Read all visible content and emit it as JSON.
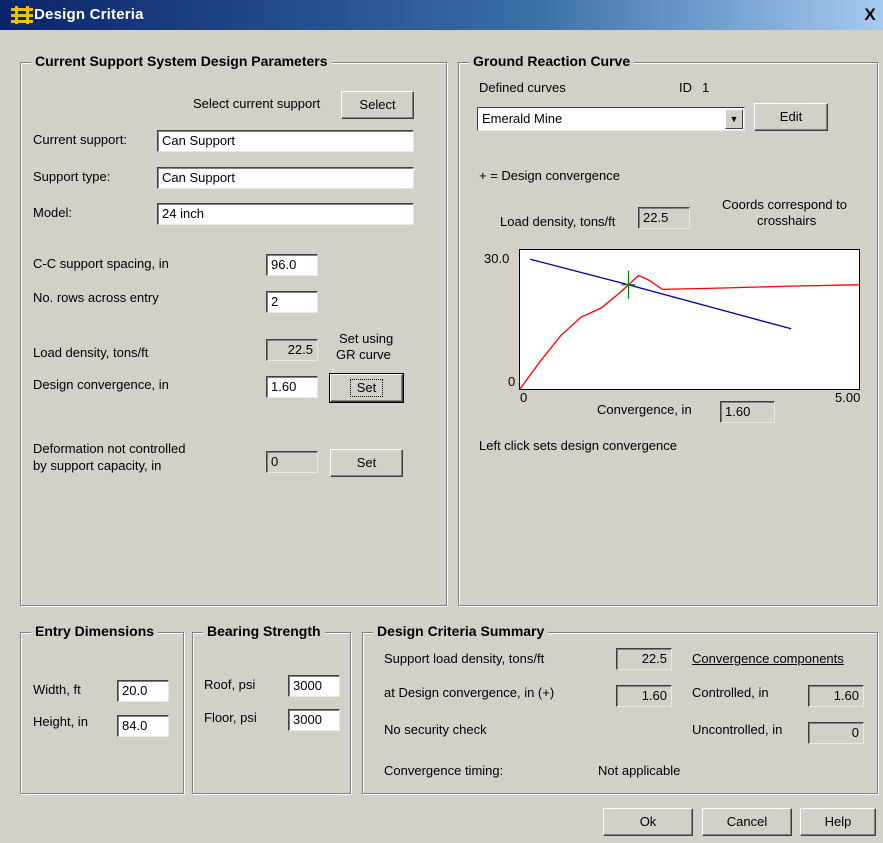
{
  "window": {
    "title": "Design Criteria",
    "close_label": "X"
  },
  "params": {
    "legend": "Current Support System Design Parameters",
    "select_label": "Select current support",
    "select_button": "Select",
    "current_support_label": "Current support:",
    "current_support_value": "Can Support",
    "support_type_label": "Support type:",
    "support_type_value": "Can Support",
    "model_label": "Model:",
    "model_value": "24 inch",
    "spacing_label": "C-C support spacing, in",
    "spacing_value": "96.0",
    "rows_label": "No. rows across entry",
    "rows_value": "2",
    "load_density_label": "Load density, tons/ft",
    "load_density_value": "22.5",
    "set_using_line1": "Set using",
    "set_using_line2": "GR curve",
    "design_conv_label": "Design convergence, in",
    "design_conv_value": "1.60",
    "set_button": "Set",
    "deform_label_line1": "Deformation not controlled",
    "deform_label_line2": "by support capacity, in",
    "deform_value": "0",
    "set_button2": "Set"
  },
  "grc": {
    "legend": "Ground Reaction Curve",
    "defined_curves_label": "Defined curves",
    "id_label": "ID",
    "id_value": "1",
    "curve_selected": "Emerald Mine",
    "edit_button": "Edit",
    "design_conv_note": "+ = Design convergence",
    "load_density_label": "Load density, tons/ft",
    "load_density_value": "22.5",
    "coords_line1": "Coords correspond to",
    "coords_line2": "crosshairs",
    "convergence_label": "Convergence, in",
    "convergence_value": "1.60",
    "left_click_note": "Left click sets design convergence"
  },
  "chart_data": {
    "type": "line",
    "xlim": [
      0,
      5.0
    ],
    "ylim": [
      0,
      30.0
    ],
    "x_tick_labels": [
      "0",
      "5.00"
    ],
    "y_tick_labels": [
      "0",
      "30.0"
    ],
    "xlabel": "Convergence, in",
    "crosshair": {
      "x": 1.6,
      "y": 22.5,
      "color": "#008000"
    },
    "series": [
      {
        "color": "#ff0000",
        "points": [
          [
            0.0,
            0.0
          ],
          [
            0.3,
            6.0
          ],
          [
            0.6,
            11.5
          ],
          [
            0.9,
            15.5
          ],
          [
            1.2,
            17.5
          ],
          [
            1.45,
            20.5
          ],
          [
            1.6,
            22.5
          ],
          [
            1.75,
            24.5
          ],
          [
            1.9,
            23.5
          ],
          [
            2.1,
            21.5
          ],
          [
            3.0,
            21.8
          ],
          [
            4.0,
            22.2
          ],
          [
            5.0,
            22.5
          ]
        ]
      },
      {
        "color": "#0000a0",
        "points": [
          [
            0.15,
            28.0
          ],
          [
            1.6,
            22.5
          ],
          [
            4.0,
            13.0
          ]
        ]
      }
    ]
  },
  "entry": {
    "legend": "Entry Dimensions",
    "width_label": "Width, ft",
    "width_value": "20.0",
    "height_label": "Height, in",
    "height_value": "84.0"
  },
  "bearing": {
    "legend": "Bearing Strength",
    "roof_label": "Roof, psi",
    "roof_value": "3000",
    "floor_label": "Floor, psi",
    "floor_value": "3000"
  },
  "summary": {
    "legend": "Design Criteria Summary",
    "support_ld_label": "Support load density, tons/ft",
    "support_ld_value": "22.5",
    "at_conv_label": "at Design convergence, in (+)",
    "at_conv_value": "1.60",
    "no_security_label": "No security check",
    "timing_label": "Convergence timing:",
    "timing_value": "Not applicable",
    "components_label": "Convergence components",
    "controlled_label": "Controlled, in",
    "controlled_value": "1.60",
    "uncontrolled_label": "Uncontrolled, in",
    "uncontrolled_value": "0"
  },
  "footer": {
    "ok": "Ok",
    "cancel": "Cancel",
    "help": "Help"
  }
}
